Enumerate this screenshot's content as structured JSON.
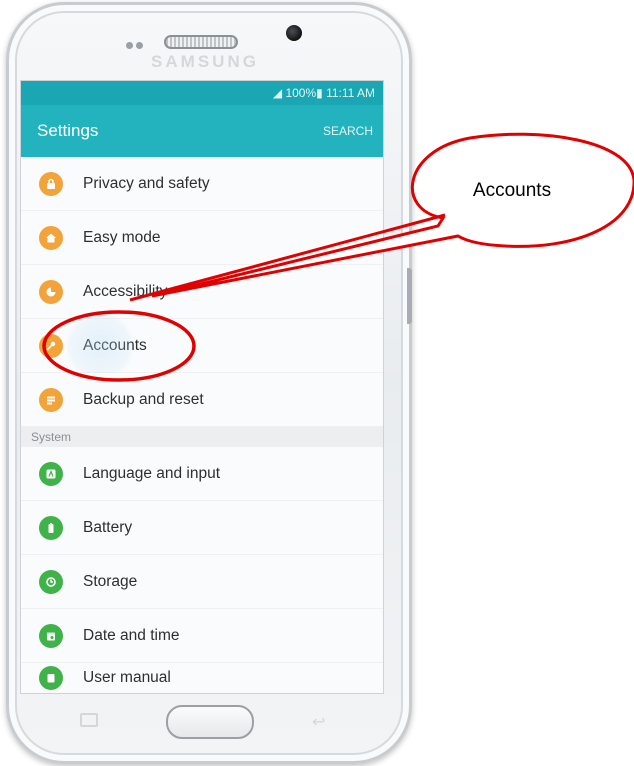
{
  "device": {
    "brand": "SAMSUNG"
  },
  "status_bar": {
    "text": "◢ 100%▮ 11:11 AM"
  },
  "app_bar": {
    "title": "Settings",
    "search_label": "SEARCH"
  },
  "list_items": [
    {
      "label": "Privacy and safety",
      "icon": "lock-icon",
      "color": "#f2a33a"
    },
    {
      "label": "Easy mode",
      "icon": "home-icon",
      "color": "#f2a33a"
    },
    {
      "label": "Accessibility",
      "icon": "accessibility-icon",
      "color": "#f2a33a"
    },
    {
      "label": "Accounts",
      "icon": "key-icon",
      "color": "#f2a33a"
    },
    {
      "label": "Backup and reset",
      "icon": "backup-icon",
      "color": "#f2a33a"
    }
  ],
  "section": {
    "label": "System"
  },
  "system_items": [
    {
      "label": "Language and input",
      "icon": "language-icon",
      "color": "#3fb24a"
    },
    {
      "label": "Battery",
      "icon": "battery-icon",
      "color": "#3fb24a"
    },
    {
      "label": "Storage",
      "icon": "storage-icon",
      "color": "#3fb24a"
    },
    {
      "label": "Date and time",
      "icon": "calendar-icon",
      "color": "#3fb24a"
    },
    {
      "label": "User manual",
      "icon": "manual-icon",
      "color": "#3fb24a"
    }
  ],
  "annotation": {
    "callout_text": "Accounts",
    "color": "#e00000"
  },
  "colors": {
    "accent": "#22b3bf",
    "status_bar": "#1aa7b3"
  }
}
